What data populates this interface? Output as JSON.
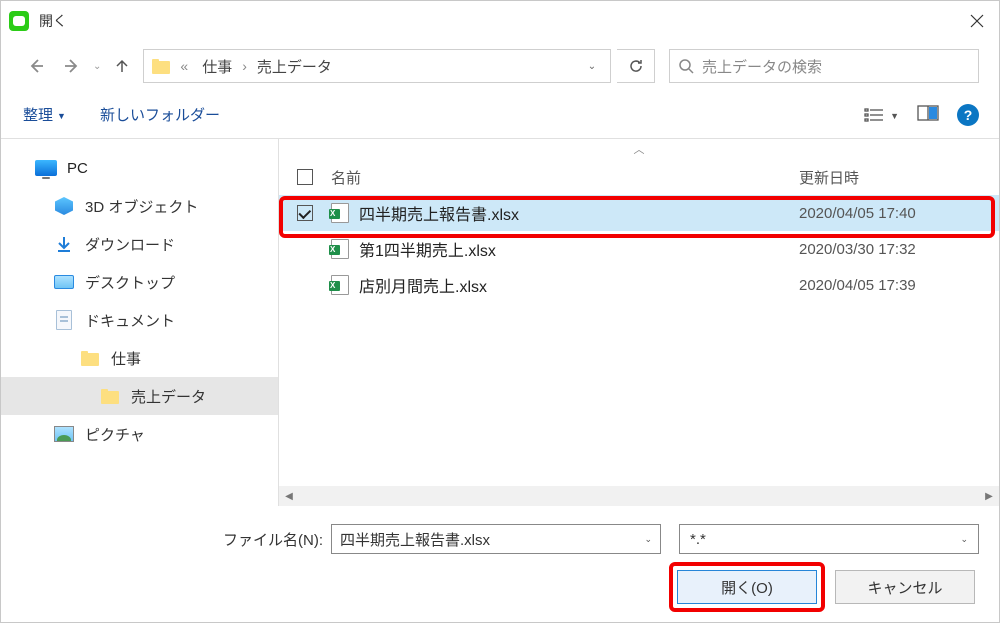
{
  "dialog": {
    "title": "開く"
  },
  "breadcrumb": {
    "segments": [
      "仕事",
      "売上データ"
    ]
  },
  "search": {
    "placeholder": "売上データの検索"
  },
  "toolbar": {
    "organize": "整理",
    "new_folder": "新しいフォルダー"
  },
  "tree": {
    "pc": "PC",
    "objects3d": "3D オブジェクト",
    "downloads": "ダウンロード",
    "desktop": "デスクトップ",
    "documents": "ドキュメント",
    "work": "仕事",
    "sales_data": "売上データ",
    "pictures": "ピクチャ"
  },
  "columns": {
    "name": "名前",
    "modified": "更新日時"
  },
  "files": [
    {
      "name": "四半期売上報告書.xlsx",
      "modified": "2020/04/05 17:40",
      "selected": true
    },
    {
      "name": "第1四半期売上.xlsx",
      "modified": "2020/03/30 17:32",
      "selected": false
    },
    {
      "name": "店別月間売上.xlsx",
      "modified": "2020/04/05 17:39",
      "selected": false
    }
  ],
  "footer": {
    "filename_label": "ファイル名(N):",
    "filename_value": "四半期売上報告書.xlsx",
    "filter_value": "*.*",
    "open_label": "開く(O)",
    "cancel_label": "キャンセル"
  }
}
